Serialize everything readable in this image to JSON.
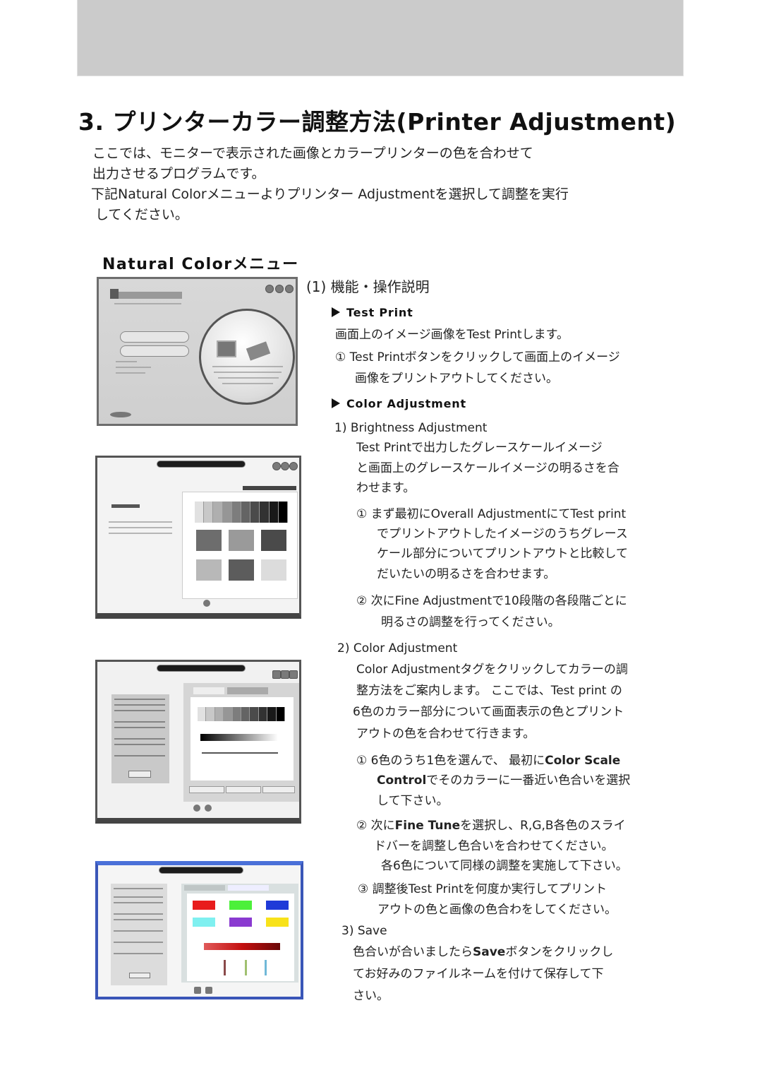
{
  "page": {
    "title": "3. プリンターカラー調整方法(Printer Adjustment)",
    "intro": [
      "ここでは、モニターで表示された画像とカラープリンターの色を合わせて",
      "出力させるプログラムです。",
      "下記Natural Colorメニューよりプリンター Adjustmentを選択して調整を実行",
      "してください。"
    ],
    "menu_heading": "Natural Colorメニュー",
    "section_title": "(1) 機能・操作説明"
  },
  "test_print": {
    "heading": "Test Print",
    "lines": [
      "画面上のイメージ画像をTest Printします。",
      "① Test Printボタンをクリックして画面上のイメージ",
      "画像をプリントアウトしてください。"
    ]
  },
  "color_adjustment": {
    "heading": "Color Adjustment",
    "brightness": {
      "heading": "1) Brightness Adjustment",
      "desc": [
        "Test Printで出力したグレースケールイメージ",
        "と画面上のグレースケールイメージの明るさを合",
        "わせます。"
      ],
      "step1": [
        "① まず最初にOverall AdjustmentにてTest print",
        "でプリントアウトしたイメージのうちグレース",
        "ケール部分についてプリントアウトと比較して",
        "だいたいの明るさを合わせます。"
      ],
      "step2": [
        "② 次にFine Adjustmentで10段階の各段階ごとに",
        "明るさの調整を行ってください。"
      ]
    },
    "color": {
      "heading": "2) Color Adjustment",
      "desc": [
        "Color Adjustmentタグをクリックしてカラーの調",
        "整方法をご案内します。 ここでは、Test print の",
        "6色のカラー部分について画面表示の色とプリント",
        "アウトの色を合わせて行きます。"
      ],
      "step1_pre": "① 6色のうち1色を選んで、 最初に",
      "step1_bold": "Color Scale",
      "step1_bold2": "Control",
      "step1_post": "でそのカラーに一番近い色合いを選択",
      "step1_end": "して下さい。",
      "step2_pre": "② 次に",
      "step2_bold": "Fine Tune",
      "step2_post": "を選択し、R,G,B各色のスライ",
      "step2_line2": "ドバーを調整し色合いを合わせてください。",
      "step2_line3": "各6色について同様の調整を実施して下さい。",
      "step3": [
        "③ 調整後Test Printを何度か実行してプリント",
        "アウトの色と画像の色合わをしてください。"
      ]
    },
    "save": {
      "heading": "3) Save",
      "line1_pre": "色合いが合いましたら",
      "line1_bold": "Save",
      "line1_post": "ボタンをクリックし",
      "lines": [
        "てお好みのファイルネームを付けて保存して下",
        "さい。"
      ]
    }
  },
  "screenshots": {
    "main_menu": {
      "name": "Natural Color main menu"
    },
    "brightness": {
      "name": "Brightness Adjustment window",
      "gray_steps": 10
    },
    "color_scale": {
      "name": "Color Adjustment window"
    },
    "fine_tune": {
      "name": "Color Adjustment fine tune window",
      "swatch_colors": [
        "#e81c1c",
        "#4cf03a",
        "#1f3ad8",
        "#7ff0f0",
        "#8a3ad0",
        "#f8e21a"
      ],
      "bar_color": "#c40f0f"
    }
  },
  "colors": {
    "band": "#cbcbcb",
    "text": "#111111"
  }
}
